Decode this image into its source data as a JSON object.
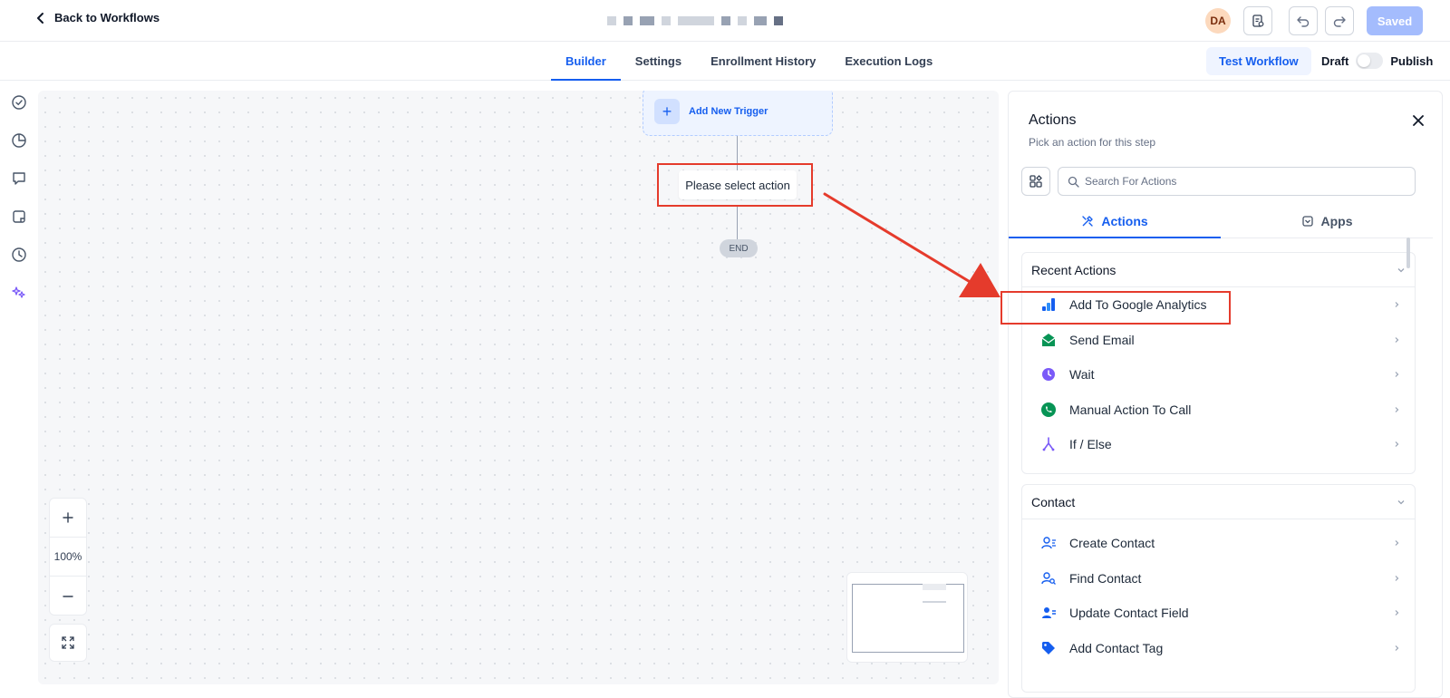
{
  "header": {
    "back_label": "Back to Workflows",
    "avatar_initials": "DA",
    "saved_label": "Saved"
  },
  "tabs": [
    {
      "label": "Builder",
      "active": true
    },
    {
      "label": "Settings",
      "active": false
    },
    {
      "label": "Enrollment History",
      "active": false
    },
    {
      "label": "Execution Logs",
      "active": false
    }
  ],
  "test_workflow_label": "Test Workflow",
  "draft_label": "Draft",
  "publish_label": "Publish",
  "canvas": {
    "trigger_label": "Add New Trigger",
    "select_action_label": "Please select action",
    "end_label": "END",
    "zoom_level": "100%"
  },
  "panel": {
    "title": "Actions",
    "subtitle": "Pick an action for this step",
    "search_placeholder": "Search For Actions",
    "tabs": [
      {
        "label": "Actions",
        "active": true
      },
      {
        "label": "Apps",
        "active": false
      }
    ],
    "sections": [
      {
        "title": "Recent Actions",
        "items": [
          {
            "label": "Add To Google Analytics",
            "icon": "google-analytics-icon"
          },
          {
            "label": "Send Email",
            "icon": "email-icon"
          },
          {
            "label": "Wait",
            "icon": "clock-icon"
          },
          {
            "label": "Manual Action To Call",
            "icon": "phone-icon"
          },
          {
            "label": "If / Else",
            "icon": "branch-icon"
          }
        ]
      },
      {
        "title": "Contact",
        "items": [
          {
            "label": "Create Contact",
            "icon": "create-contact-icon"
          },
          {
            "label": "Find Contact",
            "icon": "find-contact-icon"
          },
          {
            "label": "Update Contact Field",
            "icon": "update-contact-icon"
          },
          {
            "label": "Add Contact Tag",
            "icon": "tag-icon"
          }
        ]
      }
    ]
  },
  "colors": {
    "accent": "#155eef",
    "annotation_red": "#e53b2c",
    "saved_button": "#a4bcfd"
  }
}
